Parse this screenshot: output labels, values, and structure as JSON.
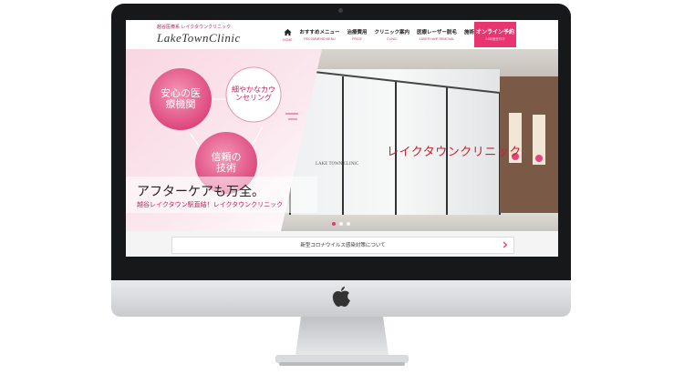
{
  "header": {
    "tagline": "越谷医療系 レイクタウンクリニック",
    "logo": "LakeTownClinic"
  },
  "nav": {
    "items": [
      {
        "label": "",
        "sub": "HOME",
        "icon": "home-icon"
      },
      {
        "label": "おすすめメニュー",
        "sub": "RECOMMEND MENU"
      },
      {
        "label": "治療費用",
        "sub": "PRICE"
      },
      {
        "label": "クリニック案内",
        "sub": "CLINIC"
      },
      {
        "label": "医療レーザー脱毛",
        "sub": "LASER HAIR REMOVAL"
      },
      {
        "label": "施術メニュー",
        "sub": "MENU"
      }
    ],
    "cta": {
      "label": "オンライン予約",
      "sub": "24時間受付中"
    }
  },
  "hero": {
    "bubbles": [
      "安心の医療機関",
      "細やかなカウンセリング",
      "信頼の技術"
    ],
    "catch_main": "アフターケアも万全。",
    "catch_sub": "越谷レイクタウン駅直結！レイクタウンクリニック",
    "sign_text": "レイクタウンクリニック",
    "sign_small": "LAKE TOWN CLINIC"
  },
  "notice": {
    "text": "新型コロナウイルス感染対策について"
  },
  "colors": {
    "accent": "#e8356f",
    "bezel": "#17181a"
  }
}
